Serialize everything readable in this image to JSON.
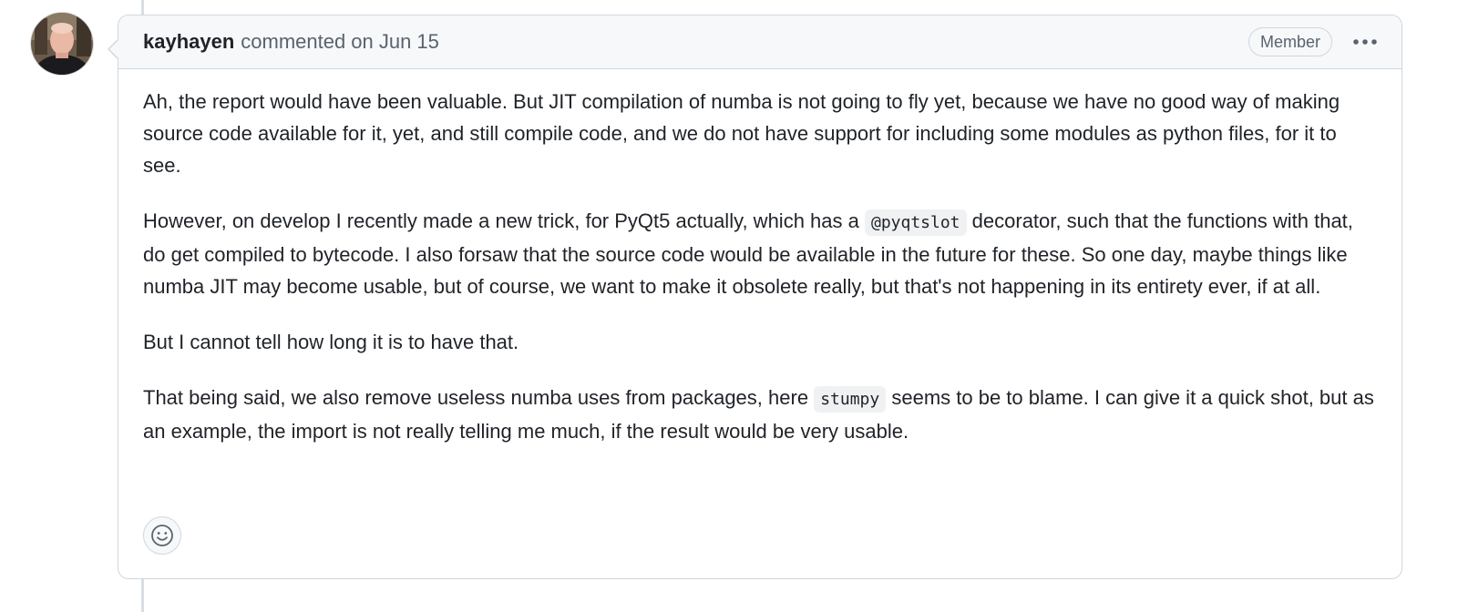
{
  "comment": {
    "author": "kayhayen",
    "verb": "commented",
    "date": "on Jun 15",
    "role_badge": "Member",
    "more_icon": "kebab-horizontal-icon",
    "paragraphs": [
      {
        "text": "Ah, the report would have been valuable. But JIT compilation of numba is not going to fly yet, because we have no good way of making source code available for it, yet, and still compile code, and we do not have support for including some modules as python files, for it to see."
      },
      {
        "before": "However, on develop I recently made a new trick, for PyQt5 actually, which has a",
        "code": "@pyqtslot",
        "after": "decorator, such that the functions with that, do get compiled to bytecode. I also forsaw that the source code would be available in the future for these. So one day, maybe things like numba JIT may become usable, but of course, we want to make it obsolete really, but that's not happening in its entirety ever, if at all."
      },
      {
        "text": "But I cannot tell how long it is to have that."
      },
      {
        "before": "That being said, we also remove useless numba uses from packages, here",
        "code": "stumpy",
        "after": "seems to be to blame. I can give it a quick shot, but as an example, the import is not really telling me much, if the result would be very usable."
      }
    ],
    "reaction_icon": "smiley-icon"
  },
  "colors": {
    "border": "#d0d7de",
    "header_bg": "#f6f8fa",
    "text": "#1f2328",
    "muted": "#59636e",
    "code_bg": "#eff1f3"
  }
}
